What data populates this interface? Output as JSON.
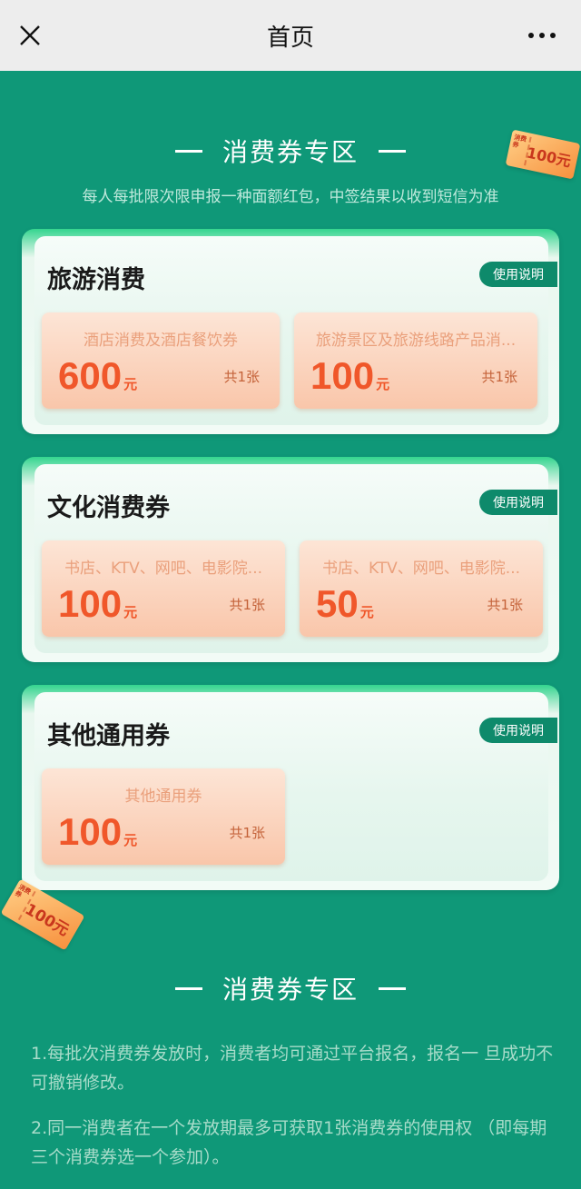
{
  "topbar": {
    "title": "首页",
    "close_icon": "close-icon",
    "more_icon": "more-dots-icon"
  },
  "section1": {
    "title": "消费券专区",
    "subtitle": "每人每批限次限申报一种面额红包，中签结果以收到短信为准"
  },
  "decor_ticket": {
    "label": "100元",
    "mini": "消费券"
  },
  "cards": [
    {
      "title": "旅游消费",
      "help": "使用说明",
      "coupons": [
        {
          "desc": "酒店消费及酒店餐饮券",
          "amount": "600",
          "unit": "元",
          "count": "共1张"
        },
        {
          "desc": "旅游景区及旅游线路产品消...",
          "amount": "100",
          "unit": "元",
          "count": "共1张"
        }
      ]
    },
    {
      "title": "文化消费券",
      "help": "使用说明",
      "coupons": [
        {
          "desc": "书店、KTV、网吧、电影院...",
          "amount": "100",
          "unit": "元",
          "count": "共1张"
        },
        {
          "desc": "书店、KTV、网吧、电影院...",
          "amount": "50",
          "unit": "元",
          "count": "共1张"
        }
      ]
    },
    {
      "title": "其他通用券",
      "help": "使用说明",
      "coupons": [
        {
          "desc": "其他通用券",
          "amount": "100",
          "unit": "元",
          "count": "共1张"
        }
      ]
    }
  ],
  "section2": {
    "title": "消费券专区",
    "rules": [
      "1.每批次消费券发放时，消费者均可通过平台报名，报名一 旦成功不可撤销修改。",
      "2.同一消费者在一个发放期最多可获取1张消费券的使用权 （即每期三个消费券选一个参加）。"
    ]
  },
  "colors": {
    "background": "#0f9878",
    "accent": "#0e8a6b",
    "amount": "#f0572a"
  }
}
